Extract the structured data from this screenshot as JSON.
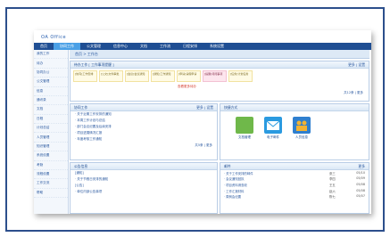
{
  "brand": "OA Office",
  "nav": [
    "首页",
    "协同工作",
    "公文管理",
    "信息中心",
    "文档",
    "工作流",
    "日程安排",
    "系统设置"
  ],
  "sidebar": [
    "我的工作",
    "待办",
    "协同办公",
    "公文管理",
    "信息",
    "通讯录",
    "文档",
    "日程",
    "计划总结",
    "人员管理",
    "知识管理",
    "系统设置",
    "考勤",
    "流程设置",
    "工作交流",
    "帮助"
  ],
  "crumb": "首页 > 工作台",
  "panel1": {
    "title": "待办工作 [ 工作事项提醒 ]",
    "right": "更多 | 设置",
    "stamps": [
      {
        "text": "[协同]工作安排",
        "pink": false
      },
      {
        "text": "[公文]文件审批",
        "pink": false
      },
      {
        "text": "[会议]会议通知",
        "pink": false
      },
      {
        "text": "[通知]工作通知",
        "pink": false
      },
      {
        "text": "[申请]请假申请",
        "pink": false
      },
      {
        "text": "[提醒]待阅事项",
        "pink": true
      },
      {
        "text": "[任务]计划任务",
        "pink": false
      }
    ],
    "note": "查看更多待办",
    "footer": "共12条 | 更多"
  },
  "panel2": {
    "title": "协同工作",
    "right": "更多 | 设置",
    "lines": [
      "· 关于近期工作安排的通知",
      "· 本周工作计划与总结",
      "· 部门会议纪要及后续安排",
      "· 项目进展情况汇报",
      "· 年度考核工作通知"
    ],
    "footer": "共5条 | 更多"
  },
  "panel3": {
    "title": "公告信息",
    "lines": [
      "[通知]",
      "· 关于节假日安排的通知",
      "[公告]",
      "· 单位内部公告事项"
    ]
  },
  "panel4": {
    "title": "快捷方式",
    "icons": [
      {
        "label": "文档管理",
        "color": "#6fb84a"
      },
      {
        "label": "电子邮件",
        "color": "#2a9ae0"
      },
      {
        "label": "人员信息",
        "color": "#2f7fcf"
      }
    ]
  },
  "panel5": {
    "title": "邮件",
    "right": "更多",
    "rows": [
      {
        "c1": "· 关于工作安排的邮件",
        "c2": "张三",
        "c3": "05/10"
      },
      {
        "c1": "· 会议通知回执",
        "c2": "李四",
        "c3": "05/09"
      },
      {
        "c1": "· 项目资料请查收",
        "c2": "王五",
        "c3": "05/08"
      },
      {
        "c1": "· 工作汇报材料",
        "c2": "赵六",
        "c3": "05/08"
      },
      {
        "c1": "· 周例会纪要",
        "c2": "陈七",
        "c3": "05/07"
      }
    ]
  }
}
